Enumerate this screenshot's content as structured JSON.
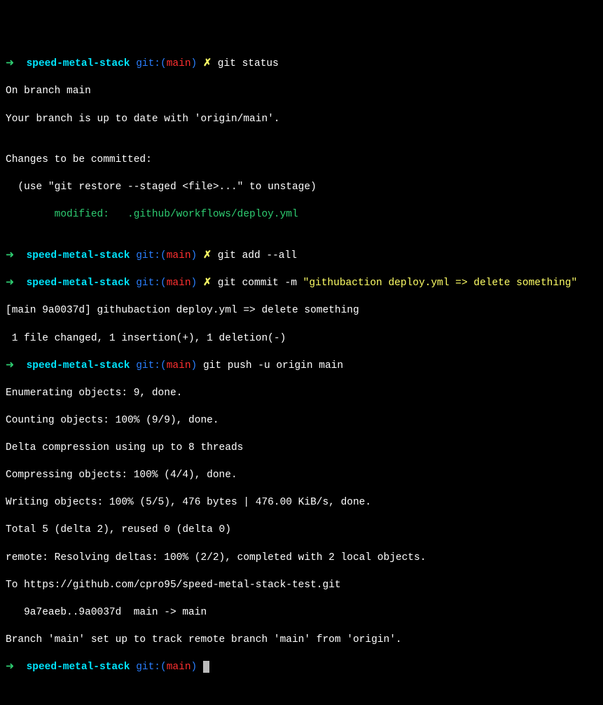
{
  "prompt": {
    "arrow": "➜",
    "dir": "speed-metal-stack",
    "git_label": "git:(",
    "git_close": ")",
    "branch": "main",
    "dirty": "✗"
  },
  "lines": {
    "cmd1": "git status",
    "out1a": "On branch main",
    "out1b": "Your branch is up to date with 'origin/main'.",
    "out1c": "",
    "out1d": "Changes to be committed:",
    "out1e": "  (use \"git restore --staged <file>...\" to unstage)",
    "out1f": "        modified:   .github/workflows/deploy.yml",
    "out1g": "",
    "cmd2": "git add --all",
    "cmd3_git": "git commit -m ",
    "cmd3_msg": "\"githubaction deploy.yml => delete something\"",
    "out3a": "[main 9a0037d] githubaction deploy.yml => delete something",
    "out3b": " 1 file changed, 1 insertion(+), 1 deletion(-)",
    "cmd4": "git push -u origin main",
    "out4a": "Enumerating objects: 9, done.",
    "out4b": "Counting objects: 100% (9/9), done.",
    "out4c": "Delta compression using up to 8 threads",
    "out4d": "Compressing objects: 100% (4/4), done.",
    "out4e": "Writing objects: 100% (5/5), 476 bytes | 476.00 KiB/s, done.",
    "out4f": "Total 5 (delta 2), reused 0 (delta 0)",
    "out4g": "remote: Resolving deltas: 100% (2/2), completed with 2 local objects.",
    "out4h": "To https://github.com/cpro95/speed-metal-stack-test.git",
    "out4i": "   9a7eaeb..9a0037d  main -> main",
    "out4j": "Branch 'main' set up to track remote branch 'main' from 'origin'."
  }
}
